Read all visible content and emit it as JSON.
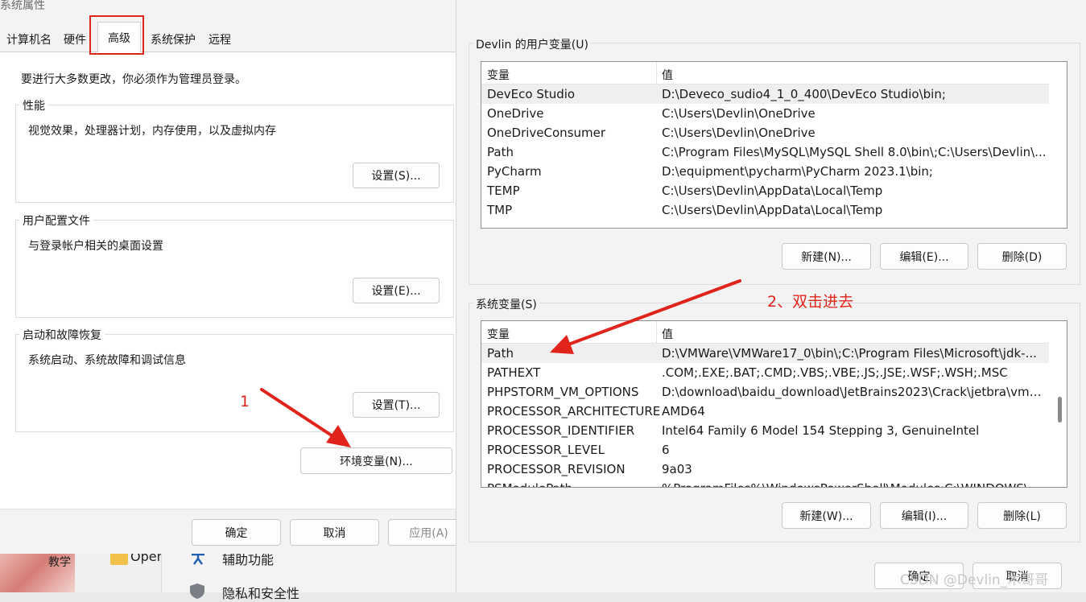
{
  "left": {
    "title": "系统属性",
    "tabs": [
      "计算机名",
      "硬件",
      "高级",
      "系统保护",
      "远程"
    ],
    "admin_notice": "要进行大多数更改，你必须作为管理员登录。",
    "groups": [
      {
        "title": "性能",
        "desc": "视觉效果，处理器计划，内存使用，以及虚拟内存",
        "button": "设置(S)..."
      },
      {
        "title": "用户配置文件",
        "desc": "与登录帐户相关的桌面设置",
        "button": "设置(E)..."
      },
      {
        "title": "启动和故障恢复",
        "desc": "系统启动、系统故障和调试信息",
        "button": "设置(T)..."
      }
    ],
    "env_button": "环境变量(N)...",
    "ok": "确定",
    "cancel": "取消",
    "apply": "应用(A)"
  },
  "desktop": {
    "thumb_label": "教学",
    "open_label": "Open",
    "item1": "辅助功能",
    "item2": "隐私和安全性"
  },
  "right": {
    "user_section_title": "Devlin 的用户变量(U)",
    "columns": {
      "name": "变量",
      "value": "值"
    },
    "user_vars": [
      {
        "name": "DevEco Studio",
        "value": "D:\\Deveco_sudio4_1_0_400\\DevEco Studio\\bin;"
      },
      {
        "name": "OneDrive",
        "value": "C:\\Users\\Devlin\\OneDrive"
      },
      {
        "name": "OneDriveConsumer",
        "value": "C:\\Users\\Devlin\\OneDrive"
      },
      {
        "name": "Path",
        "value": "C:\\Program Files\\MySQL\\MySQL Shell 8.0\\bin\\;C:\\Users\\Devlin\\..."
      },
      {
        "name": "PyCharm",
        "value": "D:\\equipment\\pycharm\\PyCharm 2023.1\\bin;"
      },
      {
        "name": "TEMP",
        "value": "C:\\Users\\Devlin\\AppData\\Local\\Temp"
      },
      {
        "name": "TMP",
        "value": "C:\\Users\\Devlin\\AppData\\Local\\Temp"
      }
    ],
    "user_buttons": {
      "new": "新建(N)...",
      "edit": "编辑(E)...",
      "delete": "删除(D)"
    },
    "sys_section_title": "系统变量(S)",
    "sys_vars": [
      {
        "name": "Path",
        "value": "D:\\VMWare\\VMWare17_0\\bin\\;C:\\Program Files\\Microsoft\\jdk-..."
      },
      {
        "name": "PATHEXT",
        "value": ".COM;.EXE;.BAT;.CMD;.VBS;.VBE;.JS;.JSE;.WSF;.WSH;.MSC"
      },
      {
        "name": "PHPSTORM_VM_OPTIONS",
        "value": "D:\\download\\baidu_download\\JetBrains2023\\Crack\\jetbra\\vmo..."
      },
      {
        "name": "PROCESSOR_ARCHITECTURE",
        "value": "AMD64"
      },
      {
        "name": "PROCESSOR_IDENTIFIER",
        "value": "Intel64 Family 6 Model 154 Stepping 3, GenuineIntel"
      },
      {
        "name": "PROCESSOR_LEVEL",
        "value": "6"
      },
      {
        "name": "PROCESSOR_REVISION",
        "value": "9a03"
      },
      {
        "name": "PSModulePath",
        "value": "%ProgramFiles%\\WindowsPowerShell\\Modules;C:\\WINDOWS\\..."
      }
    ],
    "sys_buttons": {
      "new": "新建(W)...",
      "edit": "编辑(I)...",
      "delete": "删除(L)"
    },
    "ok": "确定",
    "cancel": "取消"
  },
  "annotations": {
    "step1": "1",
    "step2": "2、双击进去",
    "color": "#e0231b"
  },
  "watermark": "CSDN @Devlin_木哥哥"
}
